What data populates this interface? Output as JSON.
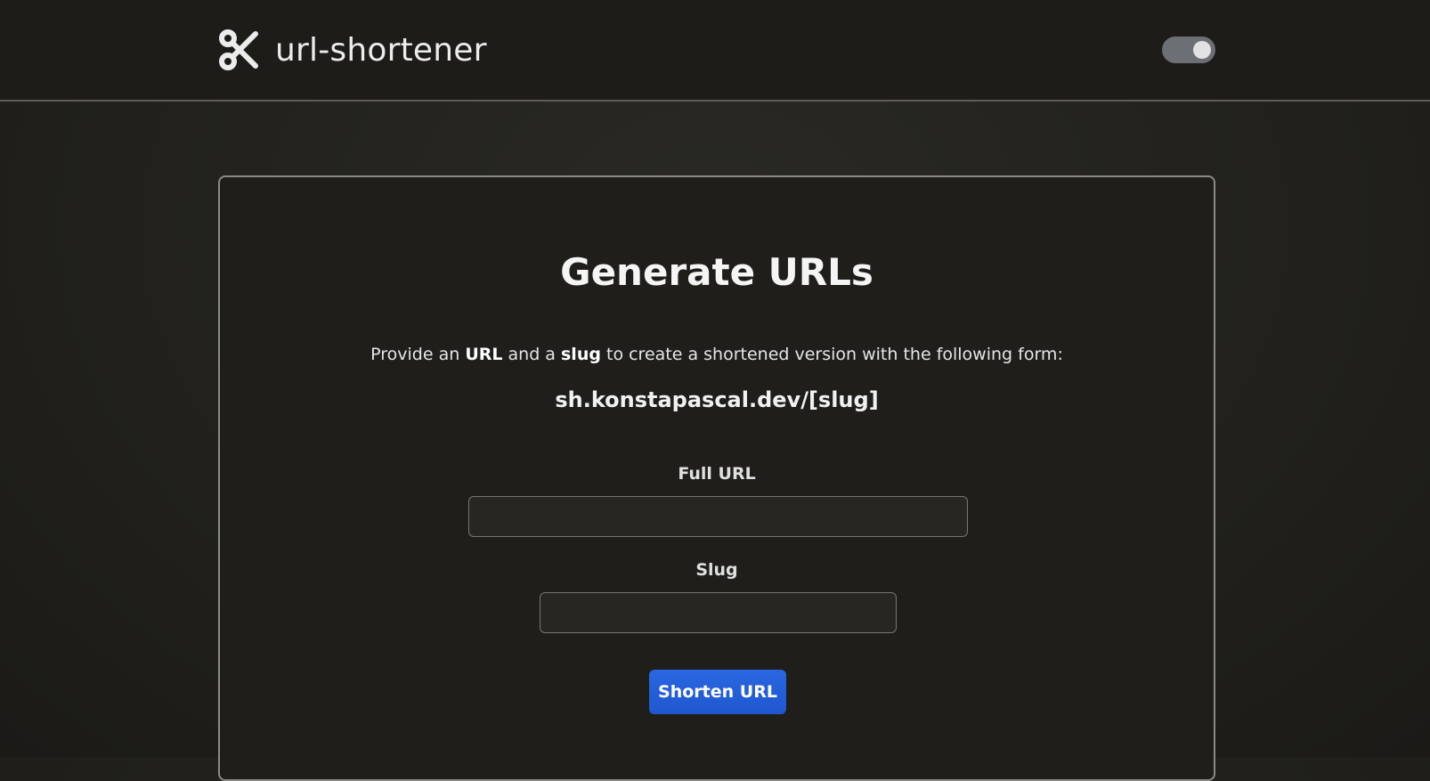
{
  "header": {
    "title": "url-shortener",
    "logo_icon": "scissors-icon",
    "theme_toggle": {
      "icon": "toggle-switch",
      "state": "on"
    }
  },
  "main": {
    "title": "Generate URLs",
    "intro": {
      "part1": "Provide an ",
      "strong1": "URL",
      "part2": " and a ",
      "strong2": "slug",
      "part3": " to create a shortened version with the following form:"
    },
    "url_pattern": "sh.konstapascal.dev/[slug]",
    "form": {
      "full_url": {
        "label": "Full URL",
        "value": "",
        "placeholder": ""
      },
      "slug": {
        "label": "Slug",
        "value": "",
        "placeholder": ""
      },
      "submit_label": "Shorten URL"
    }
  },
  "colors": {
    "accent": "#2563eb",
    "background": "#22211d",
    "card_border": "#8b8a86"
  }
}
